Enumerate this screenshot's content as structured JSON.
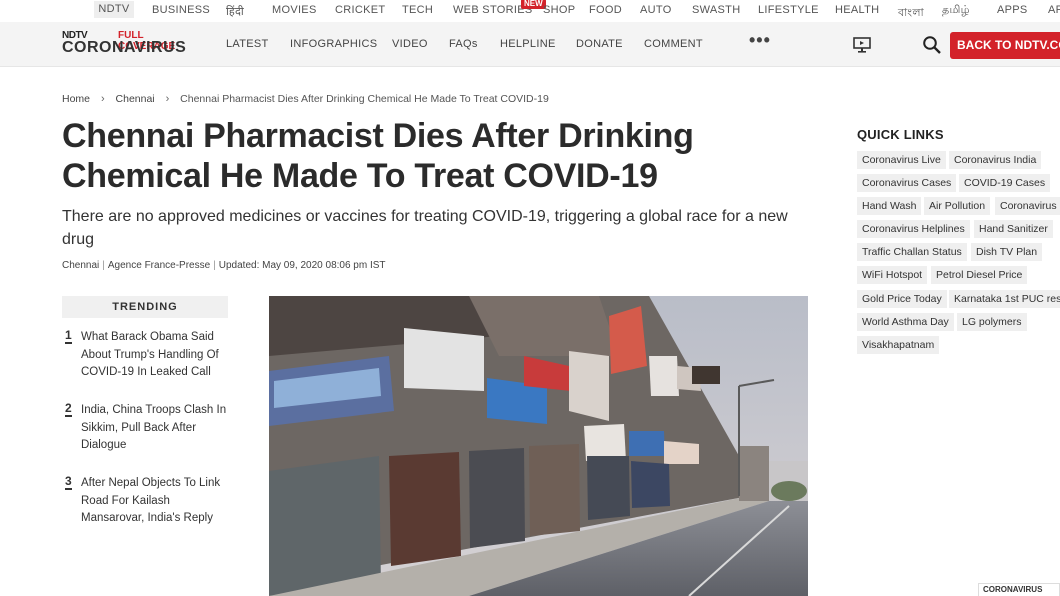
{
  "top_nav": {
    "items": [
      "NDTV",
      "BUSINESS",
      "हिंदी",
      "MOVIES",
      "CRICKET",
      "TECH",
      "WEB STORIES",
      "SHOP",
      "FOOD",
      "AUTO",
      "SWASTH",
      "LIFESTYLE",
      "HEALTH",
      "বাংলা",
      "தமிழ்",
      "APPS",
      "AR"
    ],
    "new_badge": "NEW"
  },
  "brand": {
    "ndtv": "NDTV",
    "full_coverage": "FULL COVERAGE",
    "coronavirus": "CORONAVIRUS"
  },
  "sub_nav": {
    "items": [
      "LATEST",
      "INFOGRAPHICS",
      "VIDEO",
      "FAQs",
      "HELPLINE",
      "DONATE",
      "COMMENT"
    ],
    "more": "•••",
    "back_button": "BACK TO NDTV.COM"
  },
  "breadcrumb": [
    "Home",
    "Chennai",
    "Chennai Pharmacist Dies After Drinking Chemical He Made To Treat COVID-19"
  ],
  "article": {
    "headline": "Chennai Pharmacist Dies After Drinking Chemical He Made To Treat COVID-19",
    "summary": "There are no approved medicines or vaccines for treating COVID-19, triggering a global race for a new drug",
    "byline": {
      "location": "Chennai",
      "agency": "Agence France-Presse",
      "updated": "Updated: May 09, 2020 08:06 pm IST"
    }
  },
  "trending": {
    "title": "TRENDING",
    "items": [
      {
        "num": "1",
        "text": "What Barack Obama Said About Trump's Handling Of COVID-19 In Leaked Call"
      },
      {
        "num": "2",
        "text": "India, China Troops Clash In Sikkim, Pull Back After Dialogue"
      },
      {
        "num": "3",
        "text": "After Nepal Objects To Link Road For Kailash Mansarovar, India's Reply"
      }
    ]
  },
  "quick_links": {
    "title": "QUICK LINKS",
    "links": [
      "Coronavirus Live",
      "Coronavirus India",
      "Coronavirus Cases",
      "COVID-19 Cases",
      "Hand Wash",
      "Air Pollution",
      "Coronavirus",
      "Coronavirus Helplines",
      "Hand Sanitizer",
      "Traffic Challan Status",
      "Dish TV Plan",
      "WiFi Hotspot",
      "Petrol Diesel Price",
      "Gold Price Today",
      "Karnataka 1st PUC res",
      "World Asthma Day",
      "LG polymers",
      "Visakhapatnam"
    ]
  },
  "corner_logo": "CORONAVIRUS",
  "colors": {
    "accent": "#d3222a"
  }
}
